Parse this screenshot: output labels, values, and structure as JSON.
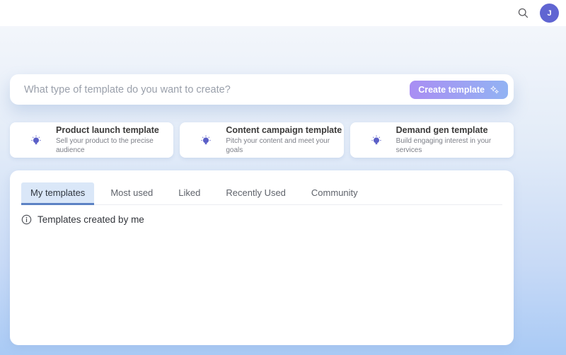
{
  "header": {
    "avatar_initial": "J"
  },
  "composer": {
    "placeholder": "What type of template do you want to create?",
    "create_button_label": "Create template"
  },
  "suggestions": [
    {
      "title": "Product launch template",
      "subtitle": "Sell your product to the precise audience"
    },
    {
      "title": "Content campaign template",
      "subtitle": "Pitch your content and meet your goals"
    },
    {
      "title": "Demand gen template",
      "subtitle": "Build engaging interest in your services"
    }
  ],
  "tabs": [
    {
      "label": "My templates"
    },
    {
      "label": "Most used"
    },
    {
      "label": "Liked"
    },
    {
      "label": "Recently Used"
    },
    {
      "label": "Community"
    }
  ],
  "panel": {
    "empty_message": "Templates created by me"
  },
  "colors": {
    "accent_indigo": "#5b5fc7",
    "avatar_bg": "#6065d2",
    "tab_active_bg": "#dae7f8",
    "tab_underline": "#5c82c4",
    "button_gradient_start": "#a98ef3",
    "button_gradient_end": "#92b3f3",
    "page_gradient_bottom": "#a9caf5"
  }
}
